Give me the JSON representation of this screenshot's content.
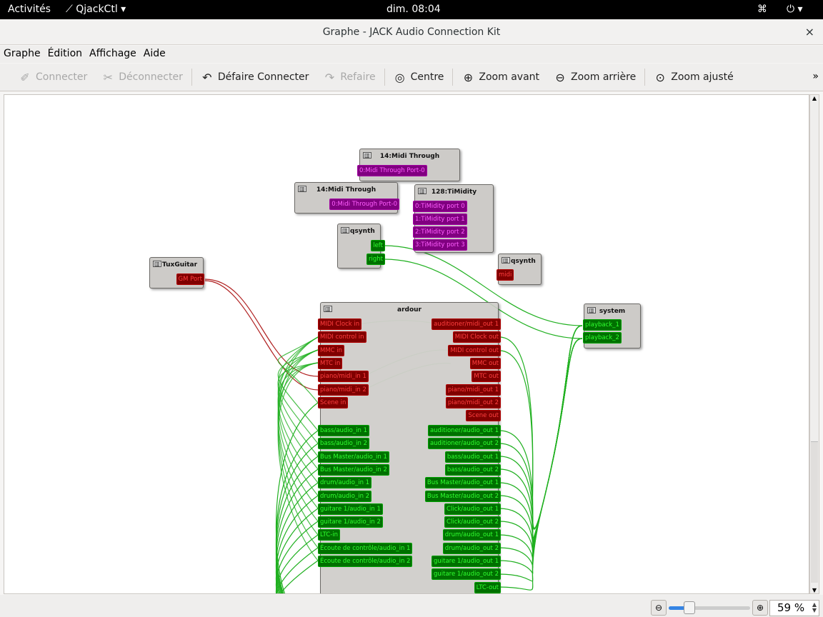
{
  "topbar": {
    "activities": "Activités",
    "app": "QjackCtl ▾",
    "clock": "dim. 08:04",
    "network_icon": "network-icon",
    "power_icon": "power-icon ▾"
  },
  "window": {
    "title": "Graphe - JACK Audio Connection Kit",
    "close": "×"
  },
  "menu": [
    "Graphe",
    "Édition",
    "Affichage",
    "Aide"
  ],
  "toolbar": [
    {
      "label": "Connecter",
      "icon": "connect-icon",
      "glyph": "✐",
      "enabled": false
    },
    {
      "label": "Déconnecter",
      "icon": "disconnect-icon",
      "glyph": "✂",
      "enabled": false
    },
    {
      "label": "Défaire Connecter",
      "icon": "undo-icon",
      "glyph": "↶",
      "enabled": true
    },
    {
      "label": "Refaire",
      "icon": "redo-icon",
      "glyph": "↷",
      "enabled": false
    },
    {
      "label": "Centre",
      "icon": "center-icon",
      "glyph": "◎",
      "enabled": true
    },
    {
      "label": "Zoom avant",
      "icon": "zoom-in-icon",
      "glyph": "⊕",
      "enabled": true
    },
    {
      "label": "Zoom arrière",
      "icon": "zoom-out-icon",
      "glyph": "⊖",
      "enabled": true
    },
    {
      "label": "Zoom ajusté",
      "icon": "zoom-fit-icon",
      "glyph": "⊙",
      "enabled": true
    }
  ],
  "toolbar_more": "»",
  "nodes": {
    "midi_through_1": {
      "title": "14:Midi Through",
      "ports": [
        "0:Midi Through Port-0"
      ]
    },
    "midi_through_2": {
      "title": "14:Midi Through",
      "ports": [
        "0:Midi Through Port-0"
      ]
    },
    "timidity": {
      "title": "128:TiMidity",
      "ports": [
        "0:TiMidity port 0",
        "1:TiMidity port 1",
        "2:TiMidity port 2",
        "3:TiMidity port 3"
      ]
    },
    "qsynth_audio": {
      "title": "qsynth",
      "ports": [
        "left",
        "right"
      ]
    },
    "qsynth_midi": {
      "title": "qsynth",
      "ports": [
        "midi"
      ]
    },
    "tuxguitar": {
      "title": "TuxGuitar",
      "ports": [
        "GM Port"
      ]
    },
    "system": {
      "title": "system",
      "ports": [
        "playback_1",
        "playback_2"
      ]
    },
    "ardour": {
      "title": "ardour",
      "midi_in": [
        "MIDI Clock in",
        "MIDI control in",
        "MMC in",
        "MTC in",
        "piano/midi_in 1",
        "piano/midi_in 2",
        "Scene in"
      ],
      "audio_in": [
        "bass/audio_in 1",
        "bass/audio_in 2",
        "Bus Master/audio_in 1",
        "Bus Master/audio_in 2",
        "drum/audio_in 1",
        "drum/audio_in 2",
        "guitare 1/audio_in 1",
        "guitare 1/audio_in 2",
        "LTC-in",
        "Écoute de contrôle/audio_in 1",
        "Écoute de contrôle/audio_in 2"
      ],
      "midi_out": [
        "auditioner/midi_out 1",
        "MIDI Clock out",
        "MIDI control out",
        "MMC out",
        "MTC out",
        "piano/midi_out 1",
        "piano/midi_out 2",
        "Scene out"
      ],
      "audio_out": [
        "auditioner/audio_out 1",
        "auditioner/audio_out 2",
        "bass/audio_out 1",
        "bass/audio_out 2",
        "Bus Master/audio_out 1",
        "Bus Master/audio_out 2",
        "Click/audio_out 1",
        "Click/audio_out 2",
        "drum/audio_out 1",
        "drum/audio_out 2",
        "guitare 1/audio_out 1",
        "guitare 1/audio_out 2",
        "LTC-out"
      ]
    }
  },
  "status": {
    "zoom_out_icon": "zoom-out-icon",
    "zoom_in_icon": "zoom-in-icon",
    "zoom_percent": 59,
    "zoom_text": "59 %"
  },
  "colors": {
    "midi": "#800000",
    "alsa": "#800080",
    "audio": "#007000",
    "wire_audio": "#20b020",
    "wire_midi": "#b02020"
  }
}
